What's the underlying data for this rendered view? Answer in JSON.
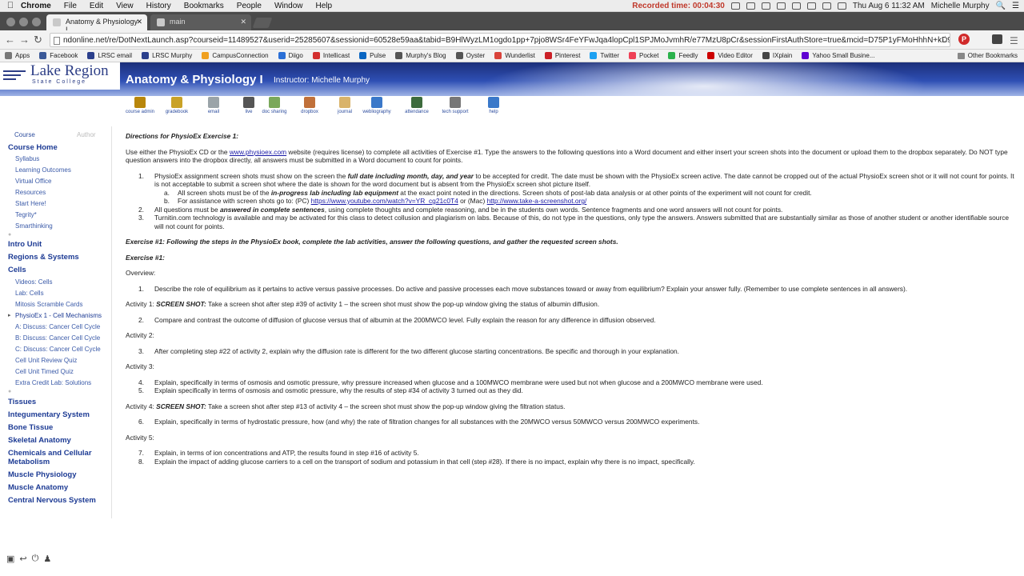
{
  "mac_menu": {
    "app": "Chrome",
    "items": [
      "File",
      "Edit",
      "View",
      "History",
      "Bookmarks",
      "People",
      "Window",
      "Help"
    ],
    "recorded": "Recorded time: 00:04:30",
    "datetime": "Thu Aug 6  11:32 AM",
    "user": "Michelle Murphy"
  },
  "tabs": [
    {
      "label": "Anatomy & Physiology I"
    },
    {
      "label": "main"
    }
  ],
  "address": {
    "url": "ndonline.net/re/DotNextLaunch.asp?courseid=11489527&userid=25285607&sessionid=60528e59aa&tabid=B9HlWyzLM1ogdo1pp+7pjo8WSr4FeYFwJqa4lopCpl1SPJMoJvmhR/e77MzU8pCr&sessionFirstAuthStore=true&mcid=D75P1yFMoHhhN+kD9T1r..."
  },
  "bookmarks": [
    {
      "label": "Apps",
      "color": "#777777"
    },
    {
      "label": "Facebook",
      "color": "#3b5998"
    },
    {
      "label": "LRSC email",
      "color": "#2b3f8c"
    },
    {
      "label": "LRSC Murphy",
      "color": "#2b3f8c"
    },
    {
      "label": "CampusConnection",
      "color": "#f0a020"
    },
    {
      "label": "Diigo",
      "color": "#2a6fd6"
    },
    {
      "label": "Intellicast",
      "color": "#d32f2f"
    },
    {
      "label": "Pulse",
      "color": "#0a66c2"
    },
    {
      "label": "Murphy's Blog",
      "color": "#555555"
    },
    {
      "label": "Oyster",
      "color": "#555555"
    },
    {
      "label": "Wunderlist",
      "color": "#d9433b"
    },
    {
      "label": "Pinterest",
      "color": "#cb2027"
    },
    {
      "label": "Twitter",
      "color": "#1da1f2"
    },
    {
      "label": "Pocket",
      "color": "#ef4056"
    },
    {
      "label": "Feedly",
      "color": "#2bb24c"
    },
    {
      "label": "Video Editor",
      "color": "#cc0000"
    },
    {
      "label": "IXplain",
      "color": "#444444"
    },
    {
      "label": "Yahoo Small Busine...",
      "color": "#6001d2"
    }
  ],
  "other_bookmarks": "Other Bookmarks",
  "logo": {
    "name": "Lake Region",
    "sub": "State College"
  },
  "course_title": "Anatomy & Physiology I",
  "instructor": "Instructor:  Michelle Murphy",
  "tools": [
    {
      "label": "course admin",
      "color": "#b8860b",
      "icon": "wand-icon"
    },
    {
      "label": "gradebook",
      "color": "#c9a227",
      "icon": "gradebook-icon"
    },
    {
      "label": "email",
      "color": "#9aa3a8",
      "icon": "email-icon"
    },
    {
      "label": "live",
      "color": "#555555",
      "icon": "live-icon"
    },
    {
      "label": "doc sharing",
      "color": "#7aa85a",
      "icon": "doc-sharing-icon"
    },
    {
      "label": "dropbox",
      "color": "#c0703a",
      "icon": "dropbox-icon"
    },
    {
      "label": "journal",
      "color": "#d9b36a",
      "icon": "journal-icon"
    },
    {
      "label": "webliography",
      "color": "#3a78c9",
      "icon": "globe-icon"
    },
    {
      "label": "attendance",
      "color": "#3d6b3d",
      "icon": "attendance-icon"
    },
    {
      "label": "tech support",
      "color": "#777777",
      "icon": "tools-icon"
    },
    {
      "label": "help",
      "color": "#3a78c9",
      "icon": "help-icon"
    }
  ],
  "sidebar": {
    "tab_course": "Course",
    "tab_author": "Author",
    "course_home": "Course Home",
    "home_items": [
      "Syllabus",
      "Learning Outcomes",
      "Virtual Office",
      "Resources",
      "Start Here!",
      "Tegrity*",
      "Smarthinking"
    ],
    "intro_unit": "Intro Unit",
    "regions": "Regions & Systems",
    "cells": "Cells",
    "cells_items": [
      "Videos: Cells",
      "Lab: Cells",
      "Mitosis Scramble Cards",
      "PhysioEx 1 - Cell Mechanisms",
      "A: Discuss: Cancer Cell Cycle",
      "B: Discuss: Cancer Cell Cycle",
      "C: Discuss: Cancer Cell Cycle",
      "Cell Unit Review Quiz",
      "Cell Unit Timed Quiz",
      "Extra Credit Lab: Solutions"
    ],
    "sections": [
      "Tissues",
      "Integumentary System",
      "Bone Tissue",
      "Skeletal Anatomy",
      "Chemicals and Cellular Metabolism",
      "Muscle Physiology",
      "Muscle Anatomy",
      "Central Nervous System"
    ]
  },
  "content": {
    "heading": "Directions for PhysioEx Exercise 1:",
    "intro_pre": "Use either the PhysioEx CD or the ",
    "intro_link": "www.physioex.com",
    "intro_post": " website (requires license) to complete all activities of Exercise #1.  Type the answers to the following questions into a Word document and either insert your screen shots into the document or upload them to the dropbox separately.  Do NOT type question answers into the dropbox directly, all answers must be submitted in a Word document to count for points.",
    "d1_num": "1.",
    "d1_pre": "PhysioEx assignment screen shots must show on the screen the ",
    "d1_bold": "full date including month, day, and year",
    "d1_post": " to be accepted for credit.  The date must be shown with the PhysioEx screen active.  The date cannot be cropped out of the actual PhysioEx screen shot or it will not count for points.  It is not acceptable to submit a screen shot where the date is shown for the word document but is absent from the PhysioEx screen shot picture itself.",
    "da_num": "a.",
    "da_pre": "All screen shots must be of the ",
    "da_bold": "in-progress lab including lab equipment",
    "da_post": " at the exact point noted in the directions.  Screen shots of post-lab data analysis or at other points of the experiment will not count for credit.",
    "db_num": "b.",
    "db_pre": "For assistance with screen shots go to: (PC) ",
    "db_link1": "https://www.youtube.com/watch?v=YR_cg21c0T4",
    "db_mid": "  or (Mac)  ",
    "db_link2": "http://www.take-a-screenshot.org/",
    "d2_num": "2.",
    "d2_pre": "All questions must be ",
    "d2_bold": "answered in complete sentences",
    "d2_post": ", using complete thoughts and complete reasoning, and be in the students own words.  Sentence fragments and one word answers will not count for points.",
    "d3_num": "3.",
    "d3_text": "Turnitin.com technology is available and may be activated for this class to detect collusion and plagiarism on labs.  Because of this, do not type in the questions, only type the answers.  Answers submitted that are substantially similar as those of another student or another identifiable source will not count for points.",
    "exercise_heading": "Exercise #1:  Following the steps in the PhysioEx book, complete the lab activities, answer the following questions, and gather the requested screen shots.",
    "exercise_label": "Exercise #1:",
    "overview": "Overview:",
    "q1_num": "1.",
    "q1": "Describe the role of equilibrium as it pertains to active versus passive processes.  Do active and passive processes each move substances toward or away from equilibrium?  Explain your answer fully.  (Remember to use complete sentences in all answers).",
    "act1_label": "Activity 1:  ",
    "act1_bold": "SCREEN SHOT:",
    "act1_text": "  Take a screen shot after step #39 of activity 1 – the screen shot must show the pop-up window giving the status of albumin diffusion.",
    "q2_num": "2.",
    "q2": "Compare and contrast the outcome of diffusion of glucose versus that of albumin at the 200MWCO level.  Fully explain the reason for any difference in diffusion observed.",
    "act2": "Activity 2:",
    "q3_num": "3.",
    "q3": "After completing step #22 of activity 2, explain why the diffusion rate is different for the two different glucose starting concentrations.  Be specific and thorough in your explanation.",
    "act3": "Activity 3:",
    "q4_num": "4.",
    "q4": "Explain, specifically in terms of osmosis and osmotic pressure, why pressure increased when glucose and a 100MWCO membrane were used but not when glucose and a 200MWCO membrane were used.",
    "q5_num": "5.",
    "q5": "Explain specifically in terms of osmosis and osmotic pressure, why the results of step #34 of activity 3 turned out as they did.",
    "act4_label": "Activity 4:  ",
    "act4_bold": "SCREEN SHOT:",
    "act4_text": "  Take a screen shot after step #13 of activity 4 – the screen shot must show the pop-up window giving the filtration status.",
    "q6_num": "6.",
    "q6": "Explain, specifically in terms of hydrostatic pressure, how (and why) the rate of filtration changes for all substances with the 20MWCO versus 50MWCO versus 200MWCO experiments.",
    "act5": "Activity 5:",
    "q7_num": "7.",
    "q7": "Explain, in terms of ion concentrations and ATP, the results found in step #16 of activity 5.",
    "q8_num": "8.",
    "q8": "Explain the impact of adding glucose carriers to a cell on the transport of sodium and potassium in that cell (step #28).  If there is no impact, explain why there is no impact, specifically."
  }
}
